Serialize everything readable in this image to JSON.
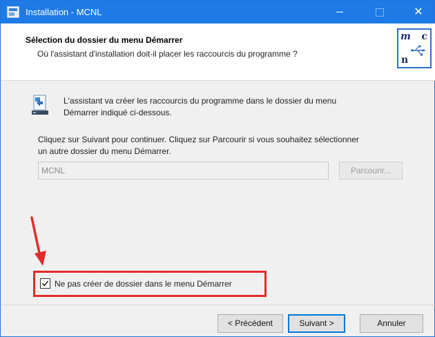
{
  "window": {
    "title": "Installation - MCNL"
  },
  "titlebar": {
    "minimize_icon": "minimize-icon",
    "maximize_icon": "maximize-icon",
    "close_glyph": "✕"
  },
  "header": {
    "title": "Sélection du dossier du menu Démarrer",
    "subtitle": "Où l'assistant d'installation doit-il placer les raccourcis du programme ?",
    "logo": {
      "m": "m",
      "c": "c",
      "n": "n",
      "icon": "usb-symbol-icon"
    }
  },
  "main": {
    "intro_line1": "L'assistant va créer les raccourcis du programme dans le dossier du menu",
    "intro_line2": "Démarrer indiqué ci-dessous.",
    "instruction_line1": "Cliquez sur Suivant pour continuer. Cliquez sur Parcourir si vous souhaitez sélectionner",
    "instruction_line2": "un autre dossier du menu Démarrer.",
    "folder_value": "MCNL",
    "browse_label": "Parcourir...",
    "checkbox_label": "Ne pas créer de dossier dans le menu Démarrer",
    "checkbox_checked": true
  },
  "buttons": {
    "previous": "< Précédent",
    "next": "Suivant >",
    "cancel": "Annuler"
  },
  "colors": {
    "titlebar": "#1e7ae6",
    "annotation": "#e32b2b",
    "default_button_border": "#0078d7"
  }
}
